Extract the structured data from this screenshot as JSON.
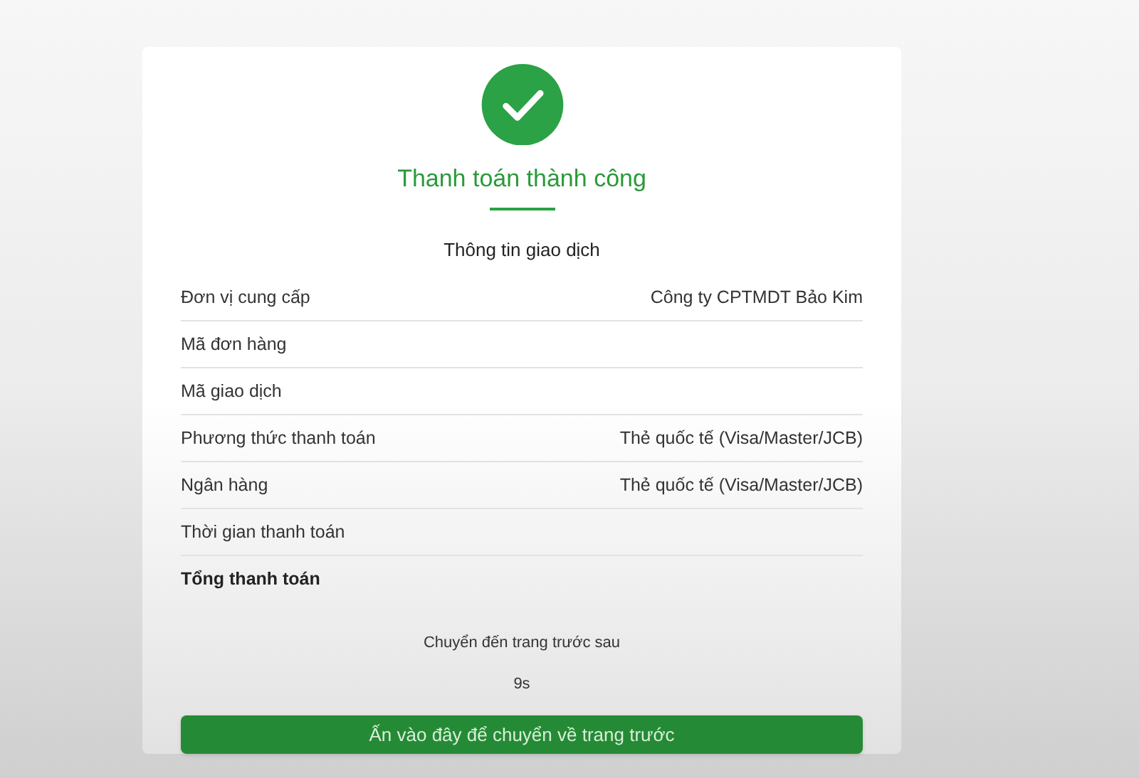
{
  "title": "Thanh toán thành công",
  "section_title": "Thông tin giao dịch",
  "rows": [
    {
      "kind": "normal",
      "label": "Đơn vị cung cấp",
      "value": "Công ty CPTMDT Bảo Kim"
    },
    {
      "kind": "normal",
      "label": "Mã đơn hàng"
    },
    {
      "kind": "normal",
      "label": "Mã giao dịch"
    },
    {
      "kind": "normal",
      "label": "Phương thức thanh toán",
      "value": "Thẻ quốc tế (Visa/Master/JCB)"
    },
    {
      "kind": "normal",
      "label": "Ngân hàng",
      "value": "Thẻ quốc tế (Visa/Master/JCB)"
    },
    {
      "kind": "normal",
      "label": "Thời gian thanh toán"
    },
    {
      "kind": "total",
      "label": "Tổng thanh toán"
    }
  ],
  "redirect_note": "Chuyển đến trang trước sau",
  "countdown": "9s",
  "button": "Ấn vào đây để chuyển về trang trước"
}
